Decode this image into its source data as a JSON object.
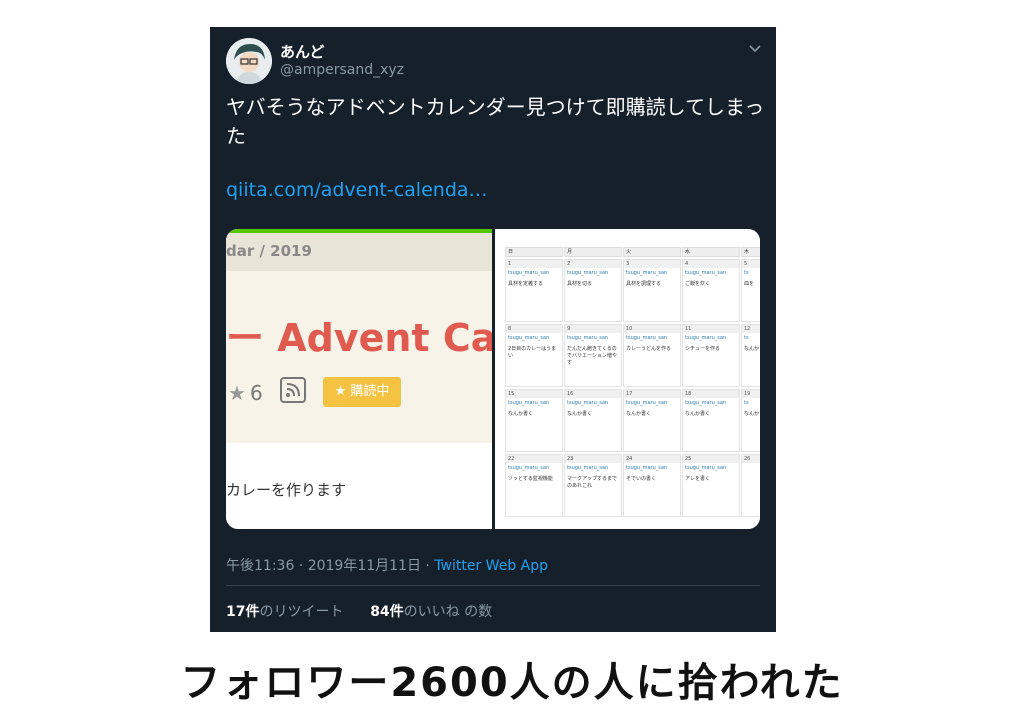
{
  "tweet": {
    "display_name": "あんど",
    "handle": "@ampersand_xyz",
    "text": "ヤバそうなアドベントカレンダー見つけて即購読してしまった",
    "link": "qiita.com/advent-calenda…",
    "timestamp": "午後11:36 · 2019年11月11日 · ",
    "source": "Twitter Web App",
    "retweets_count": "17件",
    "retweets_label": "のリツイート",
    "likes_count": "84件",
    "likes_label": "のいいね の数"
  },
  "media_left": {
    "breadcrumb": "dar /  2019",
    "title": "ー Advent Cal",
    "star_count": "6",
    "subscribe_label": "購読中",
    "bottom_text": "カレーを作ります"
  },
  "calendar": {
    "weekdays": [
      "日",
      "月",
      "火",
      "水",
      "木"
    ],
    "weeks": [
      [
        {
          "day": "1",
          "user": "tsugu_maru_san",
          "title": "具材を定義する"
        },
        {
          "day": "2",
          "user": "tsugu_maru_san",
          "title": "具材を切る"
        },
        {
          "day": "3",
          "user": "tsugu_maru_san",
          "title": "具材を調理する"
        },
        {
          "day": "4",
          "user": "tsugu_maru_san",
          "title": "ご飯を炊く"
        },
        {
          "day": "5",
          "user": "ts",
          "title": "皿を"
        }
      ],
      [
        {
          "day": "8",
          "user": "tsugu_maru_san",
          "title": "2日目のカレーはうまい"
        },
        {
          "day": "9",
          "user": "tsugu_maru_san",
          "title": "だんだん飽きてくるのでバリエーション増やす"
        },
        {
          "day": "10",
          "user": "tsugu_maru_san",
          "title": "カレーうどんを作る"
        },
        {
          "day": "11",
          "user": "tsugu_maru_san",
          "title": "シチューを作る"
        },
        {
          "day": "12",
          "user": "ts",
          "title": "なんか"
        }
      ],
      [
        {
          "day": "15",
          "user": "tsugu_maru_san",
          "title": "なんか書く"
        },
        {
          "day": "16",
          "user": "tsugu_maru_san",
          "title": "なんか書く"
        },
        {
          "day": "17",
          "user": "tsugu_maru_san",
          "title": "なんか書く"
        },
        {
          "day": "18",
          "user": "tsugu_maru_san",
          "title": "なんか書く"
        },
        {
          "day": "19",
          "user": "ts",
          "title": "なんか"
        }
      ],
      [
        {
          "day": "22",
          "user": "tsugu_maru_san",
          "title": "ゾッとする監視機能"
        },
        {
          "day": "23",
          "user": "tsugu_maru_san",
          "title": "マークアップするまでのあれこれ"
        },
        {
          "day": "24",
          "user": "tsugu_maru_san",
          "title": "そでいの書く"
        },
        {
          "day": "25",
          "user": "tsugu_maru_san",
          "title": "アレを書く"
        },
        {
          "day": "26",
          "user": "",
          "title": ""
        }
      ]
    ]
  },
  "caption": "フォロワー2600人の人に拾われた"
}
